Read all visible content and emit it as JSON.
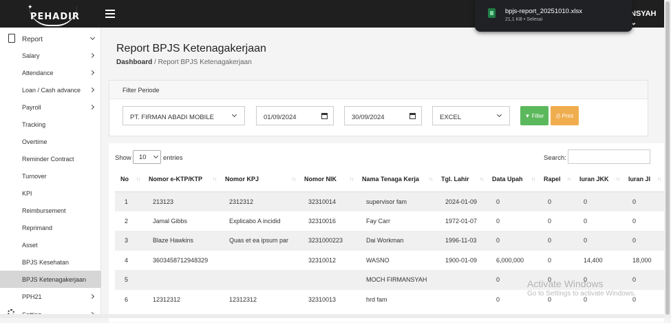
{
  "app": {
    "logo": "PEHADIR",
    "user_fragment": "NSYAH"
  },
  "download": {
    "filename": "bpjs-report_20251010.xlsx",
    "meta": "21,1 KB • Selesai"
  },
  "sidebar": {
    "section": "Report",
    "items": [
      {
        "label": "Salary",
        "has_arrow": true
      },
      {
        "label": "Attendance",
        "has_arrow": true
      },
      {
        "label": "Loan / Cash advance",
        "has_arrow": true
      },
      {
        "label": "Payroll",
        "has_arrow": true
      },
      {
        "label": "Tracking",
        "has_arrow": false
      },
      {
        "label": "Overtime",
        "has_arrow": false
      },
      {
        "label": "Reminder Contract",
        "has_arrow": false
      },
      {
        "label": "Turnover",
        "has_arrow": false
      },
      {
        "label": "KPI",
        "has_arrow": false
      },
      {
        "label": "Reimbursement",
        "has_arrow": false
      },
      {
        "label": "Reprimand",
        "has_arrow": false
      },
      {
        "label": "Asset",
        "has_arrow": false
      },
      {
        "label": "BPJS Kesehatan",
        "has_arrow": false
      },
      {
        "label": "BPJS Ketenagakerjaan",
        "has_arrow": false,
        "active": true
      },
      {
        "label": "PPH21",
        "has_arrow": true
      }
    ],
    "setting": "Setting"
  },
  "page": {
    "title": "Report BPJS Ketenagakerjaan",
    "breadcrumb_home": "Dashboard",
    "breadcrumb_sep": "/",
    "breadcrumb_current": "Report BPJS Ketenagakerjaan"
  },
  "filter": {
    "heading": "Filter Periode",
    "company": "PT. FIRMAN ABADI MOBILE",
    "date_from": "01/09/2024",
    "date_to": "30/09/2024",
    "format": "EXCEL",
    "filter_button": "Filter",
    "print_button": "Print",
    "filter_color": "#5cb85c",
    "print_color": "#f0ad4e"
  },
  "table": {
    "show_label": "Show",
    "page_size": "10",
    "entries_label": "entries",
    "search_label": "Search:",
    "columns": [
      "No",
      "Nomor e-KTP/KTP",
      "Nomor KPJ",
      "Nomor NIK",
      "Nama Tenaga Kerja",
      "Tgl. Lahir",
      "Data Upah",
      "Rapel",
      "Iuran JKK",
      "Iuran JI"
    ],
    "rows": [
      [
        "1",
        "213123",
        "2312312",
        "32310014",
        "supervisor fam",
        "2024-01-09",
        "0",
        "0",
        "0",
        "0"
      ],
      [
        "2",
        "Jamal Gibbs",
        "Explicabo A incidid",
        "32310016",
        "Fay Carr",
        "1972-01-07",
        "0",
        "0",
        "0",
        "0"
      ],
      [
        "3",
        "Blaze Hawkins",
        "Quas et ea ipsum par",
        "3231000223",
        "Dai Workman",
        "1996-11-03",
        "0",
        "0",
        "0",
        "0"
      ],
      [
        "4",
        "3603458712948329",
        "",
        "32310012",
        "WASNO",
        "1900-01-09",
        "6,000,000",
        "0",
        "14,400",
        "18,000"
      ],
      [
        "5",
        "",
        "",
        "",
        "MOCH FIRMANSYAH",
        "",
        "0",
        "0",
        "0",
        "0"
      ],
      [
        "6",
        "12312312",
        "12312312",
        "32310013",
        "hrd fam",
        "",
        "0",
        "0",
        "0",
        "0"
      ]
    ]
  },
  "watermark": {
    "title": "Activate Windows",
    "subtitle": "Go to Settings to activate Windows."
  }
}
